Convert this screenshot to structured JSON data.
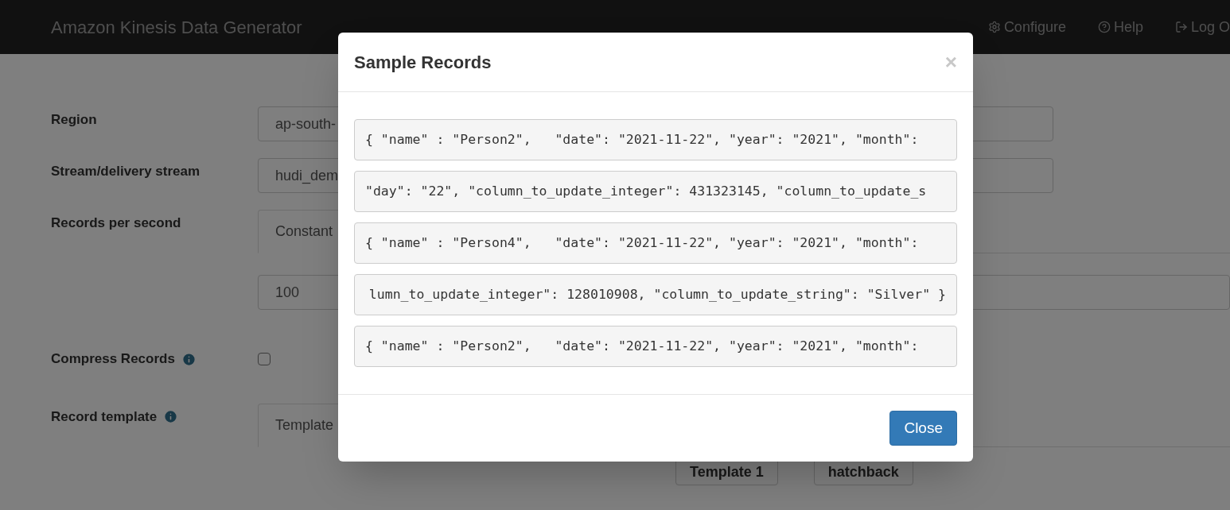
{
  "navbar": {
    "brand": "Amazon Kinesis Data Generator",
    "links": [
      {
        "label": "Configure",
        "kind": "gear"
      },
      {
        "label": "Help",
        "kind": "help"
      },
      {
        "label": "Log O",
        "kind": "logout"
      }
    ]
  },
  "form": {
    "region": {
      "label": "Region",
      "value": "ap-south-"
    },
    "stream": {
      "label": "Stream/delivery stream",
      "value": "hudi_dem"
    },
    "rate": {
      "label": "Records per second",
      "tab": "Constant",
      "value": "100"
    },
    "compress": {
      "label": "Compress Records",
      "checked": false
    },
    "template": {
      "label": "Record template",
      "tab": "Template",
      "buttons": [
        "Template 1",
        "hatchback"
      ]
    }
  },
  "modal": {
    "title": "Sample Records",
    "close_symbol": "×",
    "records": [
      {
        "text": "{ \"name\" : \"Person2\",   \"date\": \"2021-11-22\", \"year\": \"2021\", \"month\": ",
        "scrolled": false
      },
      {
        "text": "\"day\": \"22\", \"column_to_update_integer\": 431323145, \"column_to_update_s",
        "scrolled": false
      },
      {
        "text": "{ \"name\" : \"Person4\",   \"date\": \"2021-11-22\", \"year\": \"2021\", \"month\": ",
        "scrolled": false
      },
      {
        "text": "lumn_to_update_integer\": 128010908, \"column_to_update_string\": \"Silver\" }",
        "scrolled": true
      },
      {
        "text": "{ \"name\" : \"Person2\",   \"date\": \"2021-11-22\", \"year\": \"2021\", \"month\": ",
        "scrolled": false
      }
    ],
    "button": "Close"
  }
}
